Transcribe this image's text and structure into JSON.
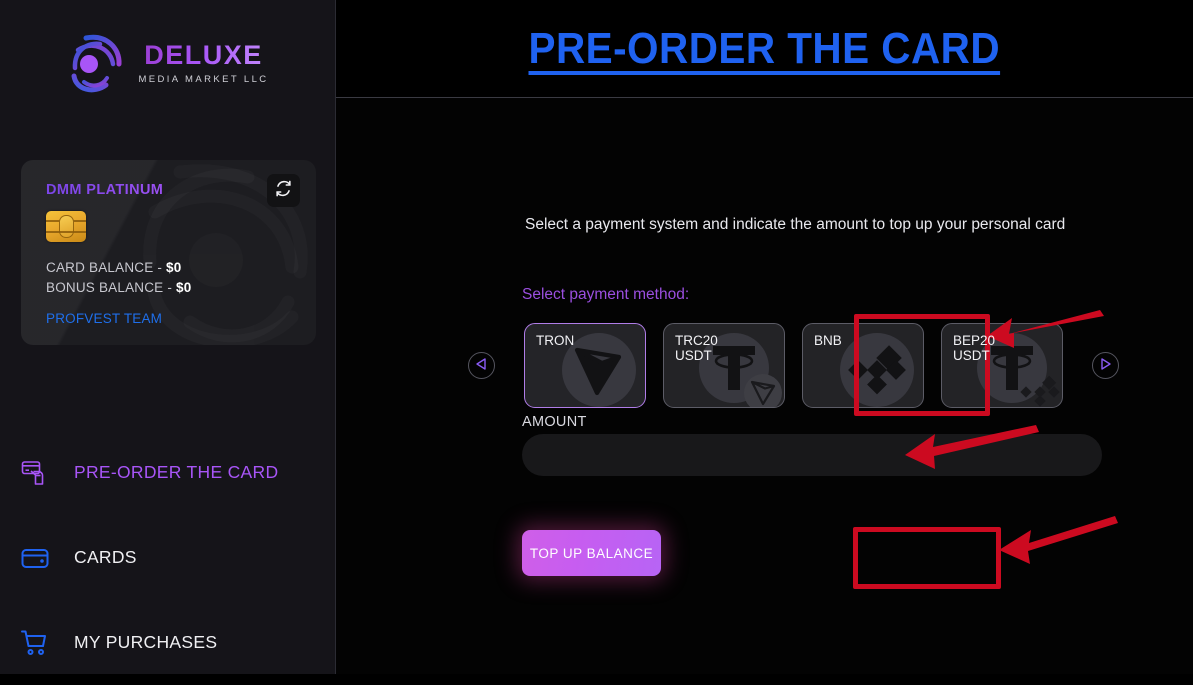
{
  "sidebar": {
    "logo": {
      "title": "DELUXE",
      "subtitle": "MEDIA MARKET LLC",
      "icon": "swirl-logo-icon"
    },
    "card": {
      "title": "DMM PLATINUM",
      "chip_icon": "emv-chip-icon",
      "card_balance_label": "CARD BALANCE - ",
      "card_balance_value": "$0",
      "bonus_balance_label": "BONUS BALANCE - ",
      "bonus_balance_value": "$0",
      "team": "PROFVEST TEAM",
      "refresh_icon": "refresh-icon"
    },
    "nav": [
      {
        "label": "PRE-ORDER THE CARD",
        "icon": "hand-card-icon",
        "active": true
      },
      {
        "label": "CARDS",
        "icon": "wallet-icon",
        "active": false
      },
      {
        "label": "MY PURCHASES",
        "icon": "shopping-cart-icon",
        "active": false
      }
    ]
  },
  "main": {
    "title": "PRE-ORDER THE CARD",
    "intro": "Select a payment system and indicate the amount to top up your personal card",
    "method_label": "Select payment method:",
    "prev_icon": "chevron-left-icon",
    "next_icon": "chevron-right-icon",
    "payment_methods": [
      {
        "name": "TRON",
        "logo": "tron-icon",
        "selected": true
      },
      {
        "name": "TRC20\nUSDT",
        "logo": "tether-tron-icon",
        "selected": false
      },
      {
        "name": "BNB",
        "logo": "binance-icon",
        "selected": false
      },
      {
        "name": "BEP20\nUSDT",
        "logo": "tether-binance-icon",
        "selected": false
      }
    ],
    "amount_label": "AMOUNT",
    "amount_value": "",
    "amount_placeholder": "",
    "topup_button": "TOP UP BALANCE"
  },
  "annotations": {
    "color": "#cc0a20",
    "boxes": [
      "tron-payment-method",
      "top-up-balance-button"
    ],
    "arrows": [
      "arrow-to-tron",
      "arrow-to-amount",
      "arrow-to-topup"
    ]
  },
  "colors": {
    "accent_purple": "#a855f7",
    "title_blue": "#1f62f0",
    "link_blue": "#1f6feb",
    "annotation_red": "#cc0a20",
    "sidebar_bg": "#151419",
    "main_bg": "#030303"
  }
}
